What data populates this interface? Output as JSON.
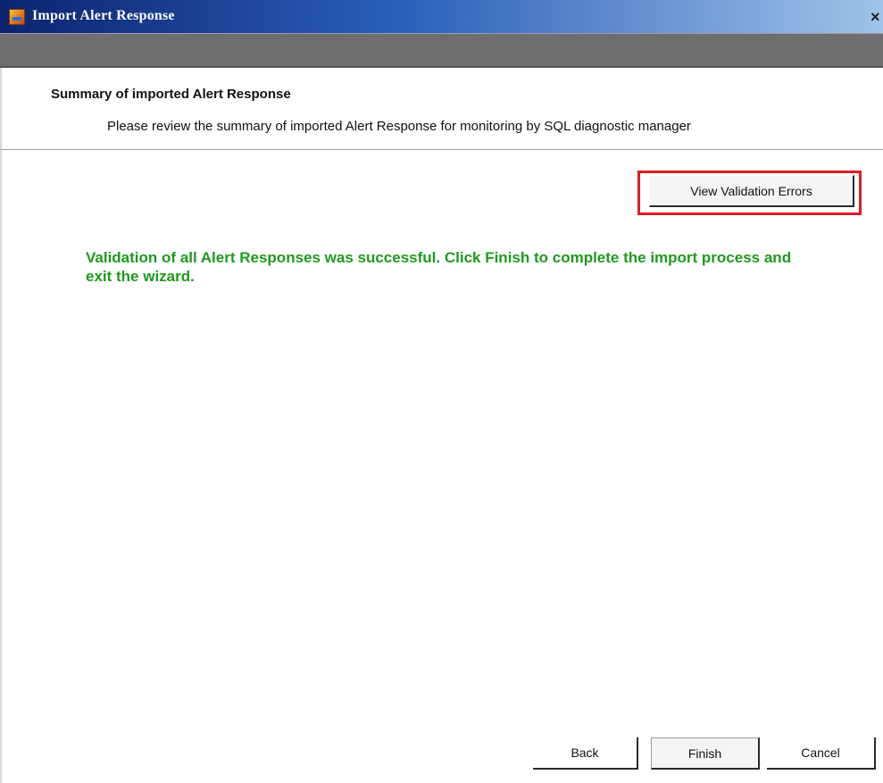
{
  "window": {
    "title": "Import Alert Response",
    "close_label": "×"
  },
  "header": {
    "title": "Summary of imported Alert Response",
    "subtitle": "Please review the summary of imported Alert Response for monitoring by SQL diagnostic manager"
  },
  "content": {
    "view_errors_label": "View Validation Errors",
    "success_message": "Validation of all Alert Responses was successful. Click Finish to complete the import process and exit the wizard.",
    "success_color": "#1e9a1e",
    "highlight_color": "#e11b22"
  },
  "footer": {
    "back_label": "Back",
    "finish_label": "Finish",
    "cancel_label": "Cancel"
  }
}
